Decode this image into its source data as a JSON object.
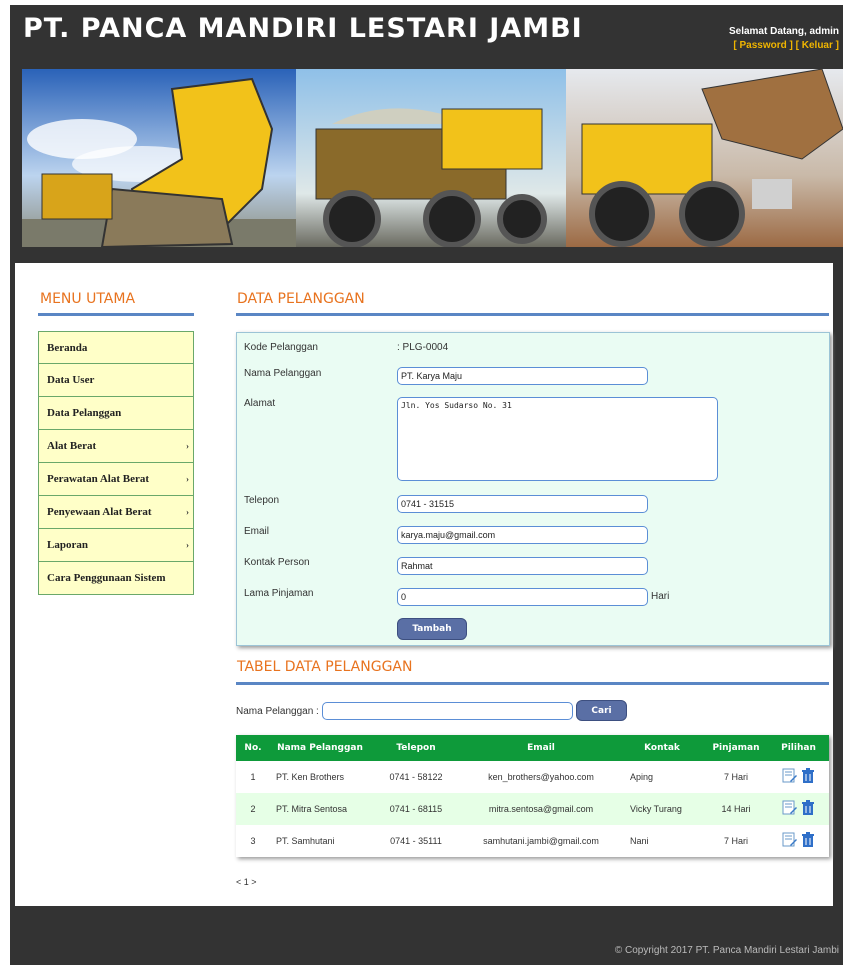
{
  "header": {
    "title": "PT. PANCA MANDIRI LESTARI JAMBI",
    "welcome": "Selamat Datang, admin",
    "password_link": "[ Password ]",
    "logout_link": "[ Keluar ]"
  },
  "menu": {
    "title": "MENU UTAMA",
    "items": [
      {
        "label": "Beranda",
        "arrow": ""
      },
      {
        "label": "Data User",
        "arrow": ""
      },
      {
        "label": "Data Pelanggan",
        "arrow": ""
      },
      {
        "label": "Alat Berat",
        "arrow": "›"
      },
      {
        "label": "Perawatan Alat Berat",
        "arrow": "›"
      },
      {
        "label": "Penyewaan Alat Berat",
        "arrow": "›"
      },
      {
        "label": "Laporan",
        "arrow": "›"
      },
      {
        "label": "Cara Penggunaan Sistem",
        "arrow": ""
      }
    ]
  },
  "form": {
    "title": "DATA PELANGGAN",
    "kode_label": "Kode Pelanggan",
    "kode_value": ": PLG-0004",
    "nama_label": "Nama Pelanggan",
    "nama_value": "PT. Karya Maju",
    "alamat_label": "Alamat",
    "alamat_value": "Jln. Yos Sudarso No. 31",
    "telepon_label": "Telepon",
    "telepon_value": "0741 - 31515",
    "email_label": "Email",
    "email_value": "karya.maju@gmail.com",
    "kontak_label": "Kontak Person",
    "kontak_value": "Rahmat",
    "lama_label": "Lama Pinjaman",
    "lama_value": "0",
    "lama_unit": "Hari",
    "submit_label": "Tambah"
  },
  "table": {
    "title": "TABEL DATA PELANGGAN",
    "search_label": "Nama Pelanggan :",
    "search_value": "",
    "search_button": "Cari",
    "columns": [
      "No.",
      "Nama Pelanggan",
      "Telepon",
      "Email",
      "Kontak",
      "Pinjaman",
      "Pilihan"
    ],
    "rows": [
      {
        "no": "1",
        "nama": "PT. Ken Brothers",
        "telepon": "0741 - 58122",
        "email": "ken_brothers@yahoo.com",
        "kontak": "Aping",
        "pinjaman": "7 Hari"
      },
      {
        "no": "2",
        "nama": "PT. Mitra Sentosa",
        "telepon": "0741 - 68115",
        "email": "mitra.sentosa@gmail.com",
        "kontak": "Vicky Turang",
        "pinjaman": "14 Hari"
      },
      {
        "no": "3",
        "nama": "PT. Samhutani",
        "telepon": "0741 - 35111",
        "email": "samhutani.jambi@gmail.com",
        "kontak": "Nani",
        "pinjaman": "7 Hari"
      }
    ],
    "pager": "< 1 >"
  },
  "footer": {
    "copyright": "© Copyright 2017 PT. Panca Mandiri Lestari Jambi"
  },
  "colors": {
    "accent_orange": "#e8731f",
    "table_header_green": "#0e9a3a",
    "rule_blue": "#5a86c4",
    "link_yellow": "#f0b500"
  },
  "icons": {
    "edit": "edit-icon",
    "delete": "delete-icon"
  }
}
